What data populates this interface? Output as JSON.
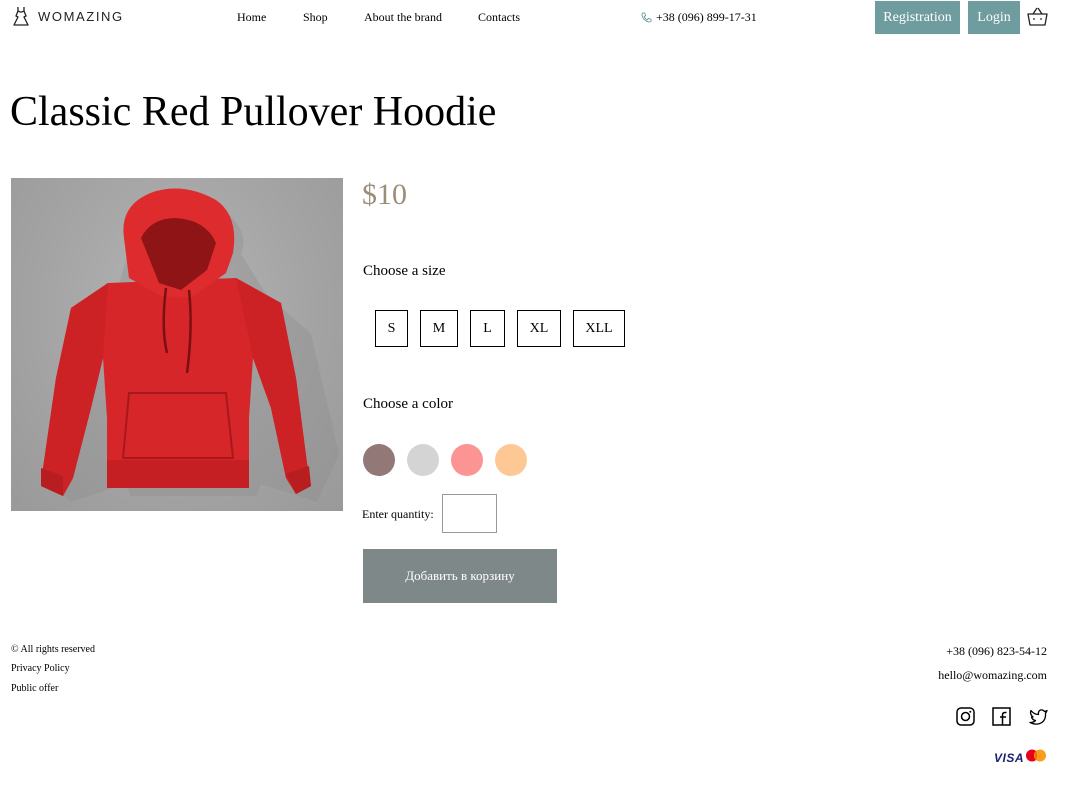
{
  "header": {
    "logo_text": "WOMAZING",
    "nav": [
      "Home",
      "Shop",
      "About the brand",
      "Contacts"
    ],
    "phone": "+38 (096) 899-17-31",
    "registration_label": "Registration",
    "login_label": "Login",
    "accent_color": "#6e9c9f"
  },
  "product": {
    "title": "Classic Red Pullover Hoodie",
    "price": "$10",
    "image_alt": "red hoodie",
    "size_label": "Choose a size",
    "sizes": [
      "S",
      "M",
      "L",
      "XL",
      "XLL"
    ],
    "color_label": "Choose a color",
    "colors": [
      "#927877",
      "#d4d4d4",
      "#fc9494",
      "#fdc894"
    ],
    "quantity_label": "Enter quantity:",
    "quantity_value": "",
    "add_to_cart_label": "Добавить в корзину"
  },
  "footer": {
    "rights": "© All rights reserved",
    "privacy": "Privacy Policy",
    "offer": "Public offer",
    "phone": "+38 (096) 823-54-12",
    "email": "hello@womazing.com",
    "social_icons": [
      "instagram-icon",
      "facebook-icon",
      "twitter-icon"
    ],
    "payment": [
      "VISA",
      "mastercard"
    ]
  }
}
